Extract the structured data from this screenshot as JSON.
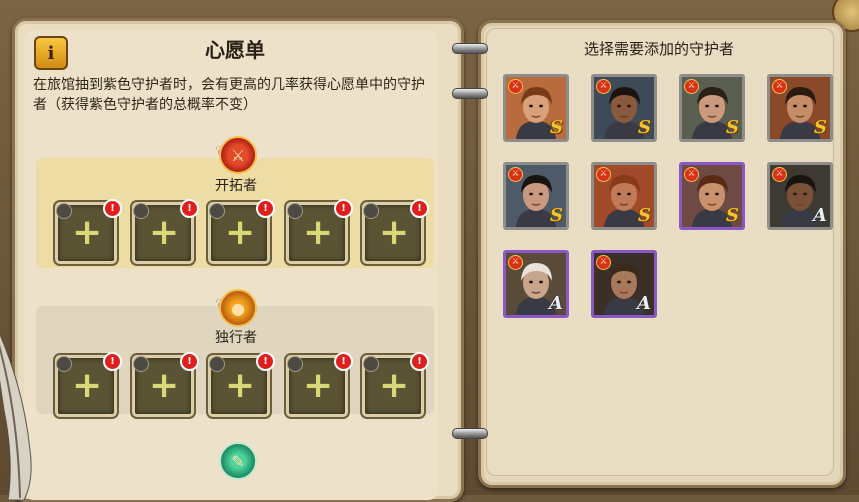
{
  "left_panel": {
    "info_label": "i",
    "title": "心愿单",
    "description": "在旅馆抽到紫色守护者时，会有更高的几率获得心愿单中的守护者（获得紫色守护者的总概率不变）",
    "sections": [
      {
        "label": "开拓者",
        "emblem_icon": "pioneer-emblem-icon",
        "color": "#d9301a",
        "slots": [
          {
            "plus": "+",
            "alert": "!"
          },
          {
            "plus": "+",
            "alert": "!"
          },
          {
            "plus": "+",
            "alert": "!"
          },
          {
            "plus": "+",
            "alert": "!"
          },
          {
            "plus": "+",
            "alert": "!"
          }
        ]
      },
      {
        "label": "独行者",
        "emblem_icon": "loner-emblem-icon",
        "color": "#f2a31c",
        "slots": [
          {
            "plus": "+",
            "alert": "!"
          },
          {
            "plus": "+",
            "alert": "!"
          },
          {
            "plus": "+",
            "alert": "!"
          },
          {
            "plus": "+",
            "alert": "!"
          },
          {
            "plus": "+",
            "alert": "!"
          }
        ]
      },
      {
        "label": "",
        "emblem_icon": "green-emblem-icon",
        "color": "#2fb37a",
        "slots": []
      }
    ]
  },
  "right_panel": {
    "title": "选择需要添加的守护者",
    "guardians": [
      {
        "rank": "S",
        "frame": "grey",
        "skin": "#d9a07a",
        "hair": "#7a3a1a",
        "bg": "#b86b3c"
      },
      {
        "rank": "S",
        "frame": "grey",
        "skin": "#8a5a3e",
        "hair": "#1c1410",
        "bg": "#3e4a58"
      },
      {
        "rank": "S",
        "frame": "grey",
        "skin": "#c99a7c",
        "hair": "#2a2018",
        "bg": "#5a5f52"
      },
      {
        "rank": "S",
        "frame": "grey",
        "skin": "#c48d68",
        "hair": "#2a1a10",
        "bg": "#8a4a2a"
      },
      {
        "rank": "S",
        "frame": "grey",
        "skin": "#c99a80",
        "hair": "#1a1410",
        "bg": "#4e5a68"
      },
      {
        "rank": "S",
        "frame": "grey",
        "skin": "#c07a58",
        "hair": "#8a3a18",
        "bg": "#a04a2a"
      },
      {
        "rank": "S",
        "frame": "purple",
        "skin": "#c9916c",
        "hair": "#5a2a14",
        "bg": "#6e4a44"
      },
      {
        "rank": "A",
        "frame": "grey",
        "skin": "#7a5038",
        "hair": "#1a1410",
        "bg": "#3e3a32"
      },
      {
        "rank": "A",
        "frame": "purple",
        "skin": "#c8a68c",
        "hair": "#e8e2d8",
        "bg": "#5a4a3a"
      },
      {
        "rank": "A",
        "frame": "purple",
        "skin": "#a8785a",
        "hair": "#3a2a1c",
        "bg": "#3a3028"
      }
    ]
  }
}
